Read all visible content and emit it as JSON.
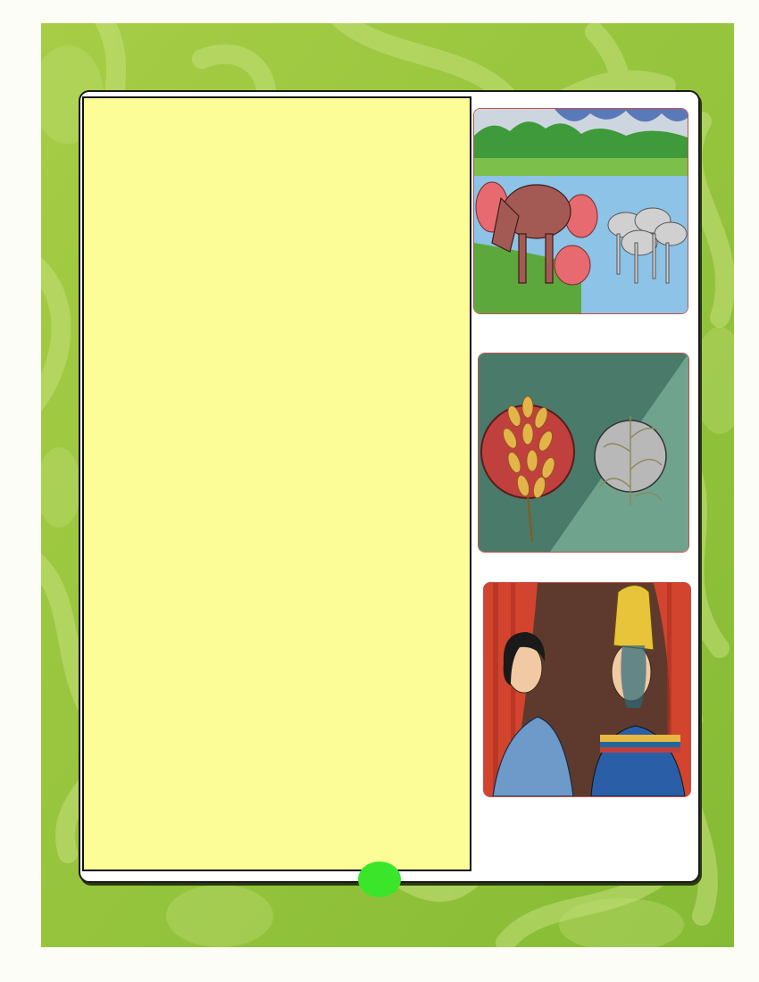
{
  "page": {
    "background_color": "#96c43c",
    "panel_color": "#fdfd98",
    "page_marker_color": "#3ae52a"
  },
  "illustrations": [
    {
      "icon": "fat-and-thin-cows-illustration"
    },
    {
      "icon": "full-and-withered-grain-illustration"
    },
    {
      "icon": "joseph-and-pharaoh-illustration"
    }
  ]
}
